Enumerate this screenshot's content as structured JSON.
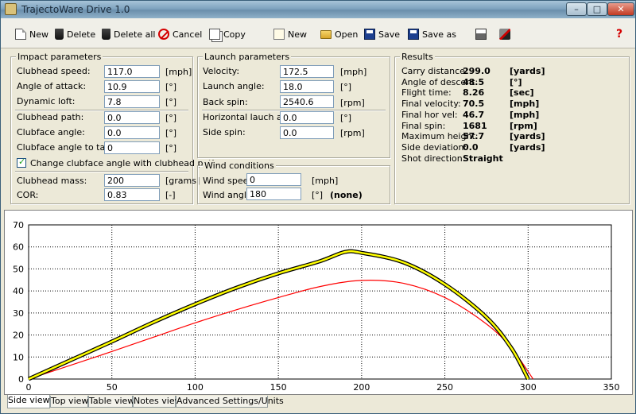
{
  "window": {
    "title": "TrajectoWare Drive 1.0"
  },
  "toolbar": {
    "new1": "New",
    "delete": "Delete",
    "delete_all": "Delete all",
    "cancel": "Cancel",
    "copy": "Copy",
    "new2": "New",
    "open": "Open",
    "save": "Save",
    "save_as": "Save as",
    "help": "?"
  },
  "impact": {
    "title": "Impact parameters",
    "clubhead_speed": {
      "label": "Clubhead speed:",
      "value": "117.0",
      "unit": "[mph]"
    },
    "angle_attack": {
      "label": "Angle of attack:",
      "value": "10.9",
      "unit": "[°]"
    },
    "dynamic_loft": {
      "label": "Dynamic loft:",
      "value": "7.8",
      "unit": "[°]"
    },
    "clubhead_path": {
      "label": "Clubhead path:",
      "value": "0.0",
      "unit": "[°]"
    },
    "clubface_angle": {
      "label": "Clubface angle:",
      "value": "0.0",
      "unit": "[°]"
    },
    "clubface_target": {
      "label": "Clubface angle to target:",
      "value": "0",
      "unit": "[°]"
    },
    "change_clubface": "Change clubface angle with clubhead path",
    "clubhead_mass": {
      "label": "Clubhead mass:",
      "value": "200",
      "unit": "[grams]"
    },
    "cor": {
      "label": "COR:",
      "value": "0.83",
      "unit": "[-]"
    }
  },
  "launch": {
    "title": "Launch parameters",
    "velocity": {
      "label": "Velocity:",
      "value": "172.5",
      "unit": "[mph]"
    },
    "launch_angle": {
      "label": "Launch angle:",
      "value": "18.0",
      "unit": "[°]"
    },
    "back_spin": {
      "label": "Back spin:",
      "value": "2540.6",
      "unit": "[rpm]"
    },
    "horiz_angle": {
      "label": "Horizontal lauch angle:",
      "value": "0.0",
      "unit": "[°]"
    },
    "side_spin": {
      "label": "Side spin:",
      "value": "0.0",
      "unit": "[rpm]"
    }
  },
  "wind": {
    "title": "Wind conditions",
    "speed": {
      "label": "Wind speed:",
      "value": "0",
      "unit": "[mph]"
    },
    "angle": {
      "label": "Wind angle:",
      "value": "180",
      "unit": "[°]",
      "desc": "(none)"
    }
  },
  "results": {
    "title": "Results",
    "rows": [
      {
        "key": "Carry distance:",
        "value": "299.0",
        "unit": "[yards]"
      },
      {
        "key": "Angle of descent:",
        "value": "48.5",
        "unit": "[°]"
      },
      {
        "key": "Flight time:",
        "value": "8.26",
        "unit": "[sec]"
      },
      {
        "key": "Final velocity:",
        "value": "70.5",
        "unit": "[mph]"
      },
      {
        "key": "Final hor vel:",
        "value": "46.7",
        "unit": "[mph]"
      },
      {
        "key": "Final spin:",
        "value": "1681",
        "unit": "[rpm]"
      },
      {
        "key": "Maximum height:",
        "value": "57.7",
        "unit": "[yards]"
      },
      {
        "key": "Side deviation:",
        "value": "0.0",
        "unit": "[yards]"
      },
      {
        "key": "Shot direction:",
        "value": "Straight",
        "unit": ""
      }
    ]
  },
  "tabs": [
    "Side view",
    "Top view",
    "Table view",
    "Notes view",
    "Advanced Settings/Units"
  ],
  "chart_data": {
    "type": "line",
    "xlim": [
      0,
      350
    ],
    "ylim": [
      0,
      70
    ],
    "x_ticks": [
      "0",
      "50",
      "100",
      "150",
      "200",
      "250",
      "300",
      "350"
    ],
    "y_ticks": [
      "0",
      "10",
      "20",
      "30",
      "40",
      "50",
      "60",
      "70"
    ],
    "grid": true,
    "series": [
      {
        "color": "#ffff00",
        "outline": "#000000",
        "x": [
          0,
          25,
          50,
          75,
          100,
          125,
          150,
          175,
          190,
          200,
          225,
          250,
          275,
          290,
          300
        ],
        "y": [
          0,
          8.5,
          17.0,
          25.8,
          34.0,
          41.5,
          48.0,
          53.5,
          57.7,
          57.3,
          53.0,
          43.0,
          28.0,
          14.0,
          0
        ]
      },
      {
        "color": "#ff0000",
        "x": [
          0,
          25,
          50,
          75,
          100,
          125,
          150,
          175,
          200,
          225,
          250,
          275,
          290,
          303
        ],
        "y": [
          0,
          6.2,
          12.5,
          19.0,
          25.5,
          31.5,
          37.0,
          42.0,
          44.8,
          43.5,
          37.0,
          25.0,
          14.0,
          0
        ]
      }
    ]
  },
  "colors": {
    "yellow_trace": "#ffff00",
    "red_trace": "#ff0000",
    "grid": "#000000"
  }
}
